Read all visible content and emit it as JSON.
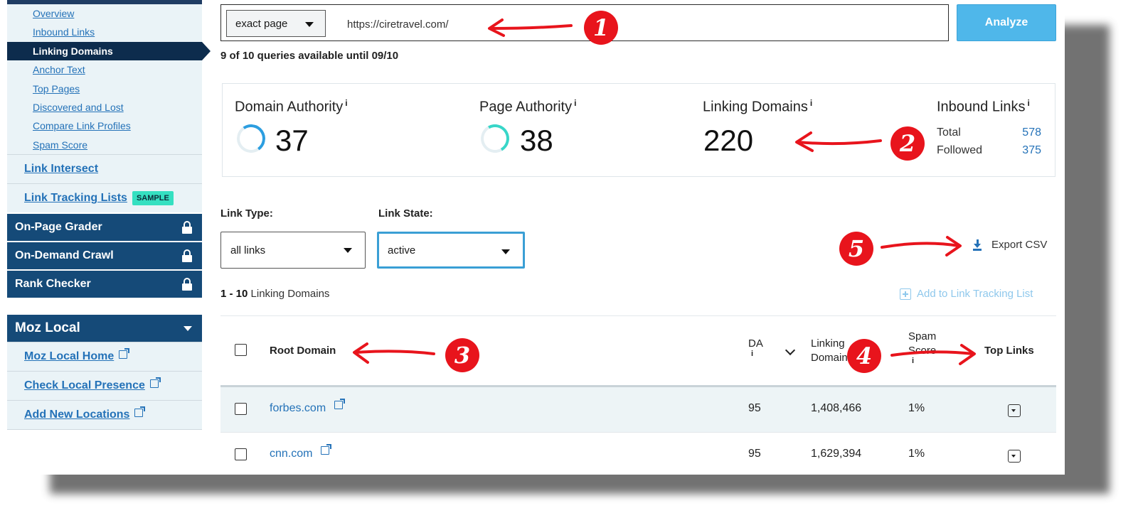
{
  "sidebar": {
    "sub_items": [
      {
        "label": "Overview",
        "active": false
      },
      {
        "label": "Inbound Links",
        "active": false
      },
      {
        "label": "Linking Domains",
        "active": true
      },
      {
        "label": "Anchor Text",
        "active": false
      },
      {
        "label": "Top Pages",
        "active": false
      },
      {
        "label": "Discovered and Lost",
        "active": false
      },
      {
        "label": "Compare Link Profiles",
        "active": false
      },
      {
        "label": "Spam Score",
        "active": false
      }
    ],
    "link_intersect": "Link Intersect",
    "link_tracking": "Link Tracking Lists",
    "sample_badge": "SAMPLE",
    "locked_items": [
      "On-Page Grader",
      "On-Demand Crawl",
      "Rank Checker"
    ],
    "moz_local": "Moz Local",
    "moz_local_items": [
      "Moz Local Home",
      "Check Local Presence",
      "Add New Locations"
    ]
  },
  "search": {
    "scope": "exact page",
    "url": "https://ciretravel.com/",
    "analyze_label": "Analyze",
    "quota": "9 of 10 queries available until 09/10"
  },
  "metrics": {
    "domain_authority": {
      "label": "Domain Authority",
      "value": "37",
      "info": "i"
    },
    "page_authority": {
      "label": "Page Authority",
      "value": "38",
      "info": "i"
    },
    "linking_domains": {
      "label": "Linking Domains",
      "value": "220",
      "info": "i"
    },
    "inbound_links": {
      "label": "Inbound Links",
      "info": "i",
      "total_label": "Total",
      "total": "578",
      "followed_label": "Followed",
      "followed": "375"
    }
  },
  "filters": {
    "link_type_label": "Link Type:",
    "link_type": "all links",
    "link_state_label": "Link State:",
    "link_state": "active",
    "export_label": "Export CSV"
  },
  "results": {
    "range": "1 - 10",
    "range_label": "Linking Domains",
    "add_tracking": "Add to Link Tracking List"
  },
  "table": {
    "headers": {
      "root_domain": "Root Domain",
      "da": "DA",
      "da_info": "i",
      "linking_domains_1": "Linking",
      "linking_domains_2": "Domains",
      "spam_1": "Spam",
      "spam_2": "Score",
      "spam_info": "i",
      "top_links": "Top Links"
    },
    "rows": [
      {
        "domain": "forbes.com",
        "da": "95",
        "linking_domains": "1,408,466",
        "spam": "1%"
      },
      {
        "domain": "cnn.com",
        "da": "95",
        "linking_domains": "1,629,394",
        "spam": "1%"
      }
    ]
  },
  "annotations": [
    "1",
    "2",
    "3",
    "4",
    "5"
  ],
  "colors": {
    "annotation_red": "#e8141c",
    "nav_dark": "#154a78",
    "link_blue": "#2472b8",
    "analyze_blue": "#4fb7ea",
    "sample_badge": "#35e0c1"
  }
}
